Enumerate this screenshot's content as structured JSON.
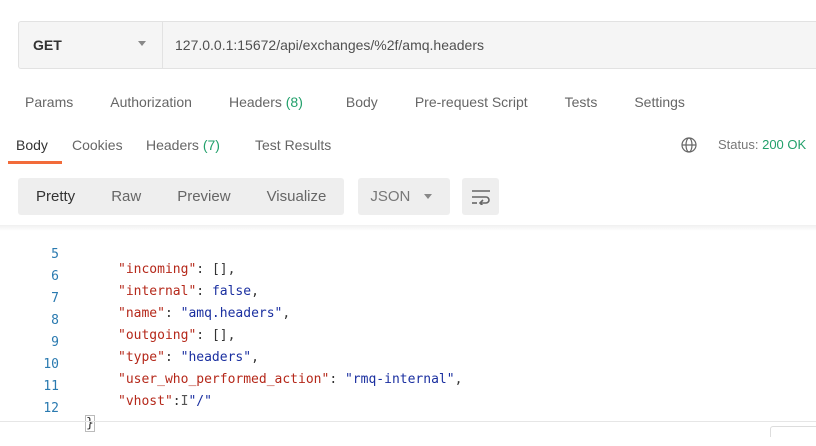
{
  "request": {
    "method": "GET",
    "url": "127.0.0.1:15672/api/exchanges/%2f/amq.headers"
  },
  "request_tabs": [
    {
      "label": "Params",
      "count": ""
    },
    {
      "label": "Authorization",
      "count": ""
    },
    {
      "label": "Headers ",
      "count": "(8)"
    },
    {
      "label": "Body",
      "count": ""
    },
    {
      "label": "Pre-request Script",
      "count": ""
    },
    {
      "label": "Tests",
      "count": ""
    },
    {
      "label": "Settings",
      "count": ""
    }
  ],
  "response_tabs": {
    "body": "Body",
    "cookies": "Cookies",
    "headers": "Headers ",
    "headers_count": "(7)",
    "test_results": "Test Results"
  },
  "status": {
    "label": "Status:",
    "value": "200 OK"
  },
  "view_modes": {
    "pretty": "Pretty",
    "raw": "Raw",
    "preview": "Preview",
    "visualize": "Visualize",
    "format": "JSON"
  },
  "icons": {
    "globe": "globe-icon",
    "wrap": "wrap-lines-icon",
    "method_caret": "chevron-down-icon",
    "format_caret": "chevron-down-icon"
  },
  "colors": {
    "accent": "#f26b3a",
    "status_ok": "#22a06b",
    "json_key": "#b5281a",
    "json_string": "#1a2fa0",
    "line_number": "#2a7ab0"
  },
  "code_lines": [
    {
      "n": "5",
      "key": "\"incoming\"",
      "sep": ": ",
      "val": "[]",
      "vtype": "p",
      "tail": ","
    },
    {
      "n": "6",
      "key": "\"internal\"",
      "sep": ": ",
      "val": "false",
      "vtype": "b",
      "tail": ","
    },
    {
      "n": "7",
      "key": "\"name\"",
      "sep": ": ",
      "val": "\"amq.headers\"",
      "vtype": "s",
      "tail": ","
    },
    {
      "n": "8",
      "key": "\"outgoing\"",
      "sep": ": ",
      "val": "[]",
      "vtype": "p",
      "tail": ","
    },
    {
      "n": "9",
      "key": "\"type\"",
      "sep": ": ",
      "val": "\"headers\"",
      "vtype": "s",
      "tail": ","
    },
    {
      "n": "10",
      "key": "\"user_who_performed_action\"",
      "sep": ": ",
      "val": "\"rmq-internal\"",
      "vtype": "s",
      "tail": ","
    },
    {
      "n": "11",
      "key": "\"vhost\"",
      "sep": ":",
      "val": "\"/\"",
      "vtype": "s",
      "tail": ""
    },
    {
      "n": "12",
      "brace": "}"
    }
  ],
  "text_cursor_glyph": "I"
}
